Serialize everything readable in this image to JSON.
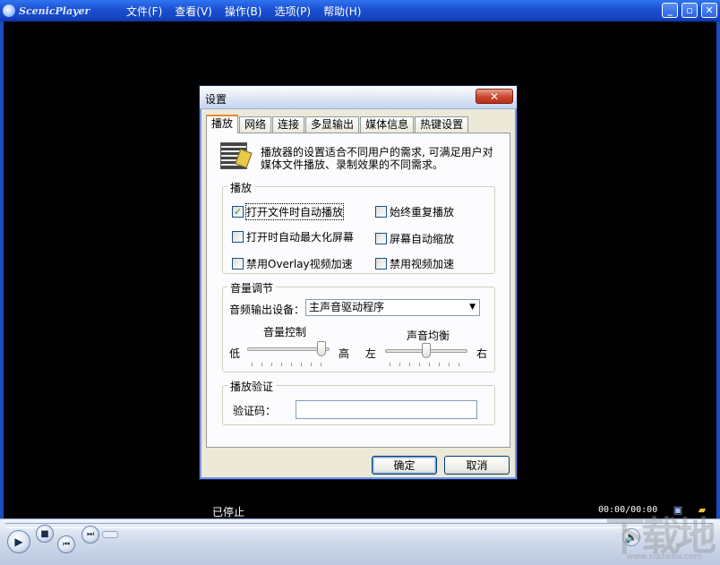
{
  "app": {
    "name": "ScenicPlayer"
  },
  "menu": [
    "文件(F)",
    "查看(V)",
    "操作(B)",
    "选项(P)",
    "帮助(H)"
  ],
  "window_controls": {
    "minimize": "_",
    "restore": "▫",
    "close": "✕"
  },
  "status": {
    "text": "已停止",
    "time": "00:00/00:00"
  },
  "watermark": {
    "text": "下载地",
    "sub": "www.xiazaiba.com"
  },
  "dialog": {
    "title": "设置",
    "close_glyph": "✕",
    "tabs": [
      "播放",
      "网络",
      "连接",
      "多显输出",
      "媒体信息",
      "热键设置"
    ],
    "active_tab": "播放",
    "intro": "播放器的设置适合不同用户的需求, 可满足用户对媒体文件播放、录制效果的不同需求。",
    "play_group": {
      "label": "播放",
      "options": [
        {
          "label": "打开文件时自动播放",
          "checked": true
        },
        {
          "label": "始终重复播放",
          "checked": false
        },
        {
          "label": "打开时自动最大化屏幕",
          "checked": false
        },
        {
          "label": "屏幕自动缩放",
          "checked": false
        },
        {
          "label": "禁用Overlay视频加速",
          "checked": false
        },
        {
          "label": "禁用视频加速",
          "checked": false
        }
      ]
    },
    "volume_group": {
      "label": "音量调节",
      "device_label": "音频输出设备：",
      "device_value": "主声音驱动程序",
      "volume_title": "音量控制",
      "volume_low": "低",
      "volume_high": "高",
      "volume_level": 0.95,
      "balance_title": "声音均衡",
      "balance_left": "左",
      "balance_right": "右",
      "balance_level": 0.5
    },
    "verify_group": {
      "label": "播放验证",
      "code_label": "验证码：",
      "code_value": ""
    },
    "ok_label": "确定",
    "cancel_label": "取消"
  }
}
